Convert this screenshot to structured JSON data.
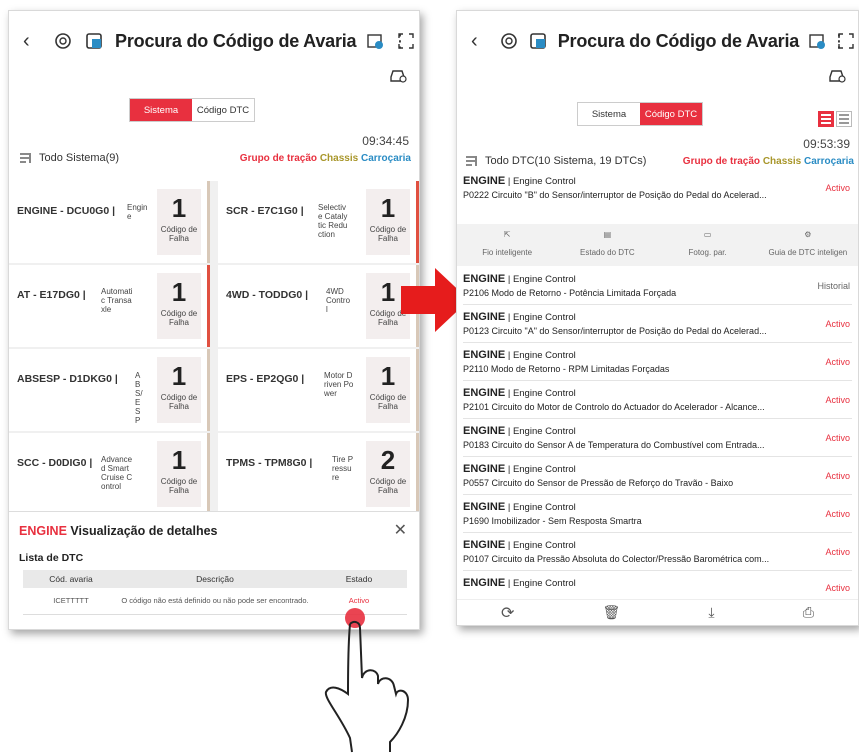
{
  "left": {
    "title": "Procura do Código de Avaria",
    "tabs": [
      "Sistema",
      "Código DTC"
    ],
    "active_tab": 0,
    "time": "09:34:45",
    "filter_label": "Todo Sistema(9)",
    "filter_tags": [
      "Grupo de tração",
      "Chassis",
      "Carroçaria"
    ],
    "systems": [
      {
        "name": "ENGINE - DCU0G0 |",
        "desc": "Engine",
        "count": "1",
        "count_label": "Código de Falha"
      },
      {
        "name": "SCR - E7C1G0 |",
        "desc": "Selective Catalytic Reduction",
        "count": "1",
        "count_label": "Código de Falha"
      },
      {
        "name": "AT - E17DG0 |",
        "desc": "Automatic Transaxle",
        "count": "1",
        "count_label": "Código de Falha"
      },
      {
        "name": "4WD - TODDG0 |",
        "desc": "4WD Control",
        "count": "1",
        "count_label": "Código de Falha"
      },
      {
        "name": "ABSESP - D1DKG0 |",
        "desc": "ABS/ESP",
        "count": "1",
        "count_label": "Código de Falha"
      },
      {
        "name": "EPS - EP2QG0 |",
        "desc": "Motor Driven Power",
        "count": "1",
        "count_label": "Código de Falha"
      },
      {
        "name": "SCC - D0DIG0 |",
        "desc": "Advanced Smart Cruise Control",
        "count": "1",
        "count_label": "Código de Falha"
      },
      {
        "name": "TPMS - TPM8G0 |",
        "desc": "Tire Pressure",
        "count": "2",
        "count_label": "Código de Falha"
      }
    ],
    "detail": {
      "system": "ENGINE",
      "title": "Visualização de detalhes",
      "list_label": "Lista de DTC",
      "headers": [
        "Cód. avaria",
        "Descrição",
        "Estado"
      ],
      "row": {
        "code": "ICETTTTT",
        "desc": "O código não está definido ou não pode ser encontrado.",
        "state": "Activo"
      }
    }
  },
  "right": {
    "title": "Procura do Código de Avaria",
    "tabs": [
      "Sistema",
      "Código DTC"
    ],
    "active_tab": 1,
    "time": "09:53:39",
    "filter_label": "Todo DTC(10 Sistema, 19 DTCs)",
    "filter_tags": [
      "Grupo de tração",
      "Chassis",
      "Carroçaria"
    ],
    "actions": [
      "Fio inteligente",
      "Estado do DTC",
      "Fotog. par.",
      "Guia de DTC inteligen"
    ],
    "dtcs": [
      {
        "sys": "ENGINE",
        "ctrl": "Engine Control",
        "text": "P0222 Circuito \"B\" do Sensor/interruptor de Posição do Pedal do Acelerad...",
        "state": "Activo"
      },
      {
        "sys": "ENGINE",
        "ctrl": "Engine Control",
        "text": "P2106 Modo de Retorno - Potência Limitada Forçada",
        "state": "Historial"
      },
      {
        "sys": "ENGINE",
        "ctrl": "Engine Control",
        "text": "P0123 Circuito \"A\" do Sensor/interruptor de Posição do Pedal do Acelerad...",
        "state": "Activo"
      },
      {
        "sys": "ENGINE",
        "ctrl": "Engine Control",
        "text": "P2110 Modo de Retorno - RPM Limitadas Forçadas",
        "state": "Activo"
      },
      {
        "sys": "ENGINE",
        "ctrl": "Engine Control",
        "text": "P2101 Circuito do Motor de Controlo do Actuador do Acelerador - Alcance...",
        "state": "Activo"
      },
      {
        "sys": "ENGINE",
        "ctrl": "Engine Control",
        "text": "P0183 Circuito do Sensor A de Temperatura do Combustível com Entrada...",
        "state": "Activo"
      },
      {
        "sys": "ENGINE",
        "ctrl": "Engine Control",
        "text": "P0557 Circuito do Sensor de Pressão de Reforço do Travão - Baixo",
        "state": "Activo"
      },
      {
        "sys": "ENGINE",
        "ctrl": "Engine Control",
        "text": "P1690 Imobilizador - Sem Resposta Smartra",
        "state": "Activo"
      },
      {
        "sys": "ENGINE",
        "ctrl": "Engine Control",
        "text": "P0107 Circuito da Pressão Absoluta do Colector/Pressão Barométrica com...",
        "state": "Activo"
      },
      {
        "sys": "ENGINE",
        "ctrl": "Engine Control",
        "text": "",
        "state": "Activo"
      }
    ]
  },
  "colors": {
    "accent": "#e8303f",
    "chassis": "#a8962a",
    "body": "#2a8cc4"
  }
}
